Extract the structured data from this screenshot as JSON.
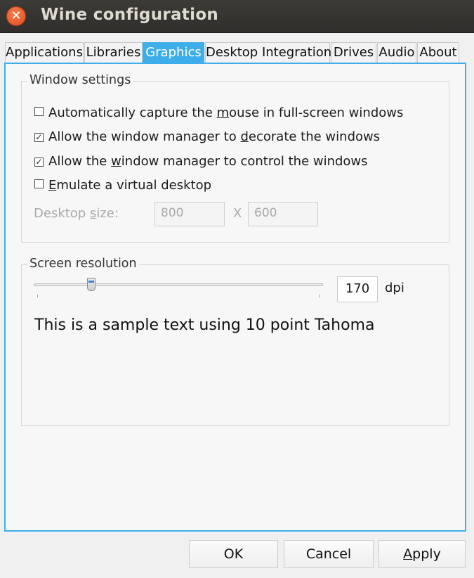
{
  "window": {
    "title": "Wine configuration"
  },
  "tabs": [
    {
      "label": "Applications"
    },
    {
      "label": "Libraries"
    },
    {
      "label": "Graphics"
    },
    {
      "label": "Desktop Integration"
    },
    {
      "label": "Drives"
    },
    {
      "label": "Audio"
    },
    {
      "label": "About"
    }
  ],
  "window_settings": {
    "title": "Window settings",
    "capture_mouse": {
      "pre": "Automatically capture the ",
      "u": "m",
      "post": "ouse in full-screen windows",
      "checked": false
    },
    "decorate": {
      "pre": "Allow the window manager to ",
      "u": "d",
      "post": "ecorate the windows",
      "checked": true
    },
    "control": {
      "pre": "Allow the ",
      "u": "w",
      "post": "indow manager to control the windows",
      "checked": true
    },
    "virtual_desktop": {
      "pre": "",
      "u": "E",
      "post": "mulate a virtual desktop",
      "checked": false
    },
    "desktop_size": {
      "pre": "Desktop ",
      "u": "s",
      "post": "ize:",
      "width": "800",
      "sep": "X",
      "height": "600"
    }
  },
  "screen_resolution": {
    "title": "Screen resolution",
    "dpi": "170",
    "unit": "dpi",
    "sample": "This is a sample text using 10 point Tahoma"
  },
  "buttons": {
    "ok": "OK",
    "cancel": "Cancel",
    "apply_u": "A",
    "apply_rest": "pply"
  }
}
